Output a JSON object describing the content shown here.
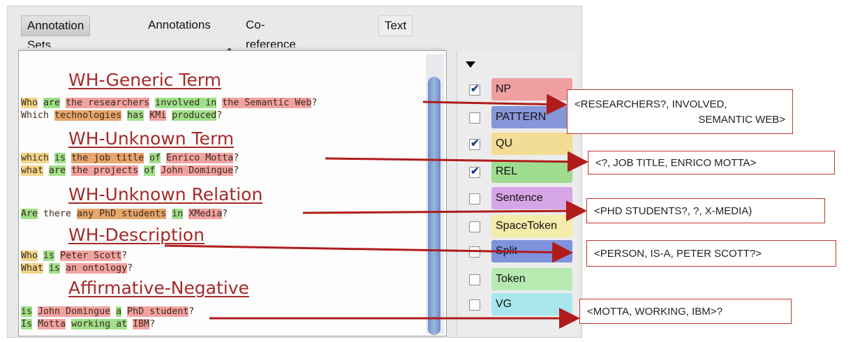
{
  "tabs": [
    "Annotation Sets",
    "Annotations",
    "Co-reference Editor",
    "Text"
  ],
  "headings": [
    "WH-Generic Term",
    "WH-Unknown Term",
    "WH-Unknown Relation",
    "WH-Description",
    "Affirmative-Negative"
  ],
  "text_lines": [
    "Who are the researchers involved in the Semantic Web?",
    "Which technologies has KMi produced?",
    "which is the job title of Enrico Motta?",
    "what are the projects of John Domingue?",
    "Are there any PhD students in XMedia?",
    "Who is Peter Scott?",
    "What is an ontology?",
    "is John Domingue a PhD student?",
    "Is Motta working at IBM?"
  ],
  "annotation_types": [
    {
      "label": "NP",
      "checked": true,
      "color": "#f0a0a0"
    },
    {
      "label": "PATTERN",
      "checked": false,
      "color": "#8796d8"
    },
    {
      "label": "QU",
      "checked": true,
      "color": "#f3dc95"
    },
    {
      "label": "REL",
      "checked": true,
      "color": "#9fdc8f"
    },
    {
      "label": "Sentence",
      "checked": false,
      "color": "#d7a6e6"
    },
    {
      "label": "SpaceToken",
      "checked": false,
      "color": "#f3ecaa"
    },
    {
      "label": "Split",
      "checked": false,
      "color": "#7e93dc"
    },
    {
      "label": "Token",
      "checked": false,
      "color": "#b6eab0"
    },
    {
      "label": "VG",
      "checked": false,
      "color": "#a6e6ec"
    }
  ],
  "callouts": [
    {
      "line1": "<RESEARCHERS?, INVOLVED,",
      "line2": "SEMANTIC WEB>"
    },
    {
      "line1": "<?, JOB TITLE, ENRICO MOTTA>"
    },
    {
      "line1": "<PHD STUDENTS?, ?,  X-MEDIA)"
    },
    {
      "line1": "<PERSON, IS-A, PETER SCOTT?>"
    },
    {
      "line1": "<MOTTA, WORKING, IBM>?"
    }
  ],
  "colors": {
    "arrow": "#b01c1c",
    "heading": "#a52a2a",
    "np": "#f3a2a2",
    "rel": "#9fe08a",
    "qu": "#f1d58a"
  }
}
